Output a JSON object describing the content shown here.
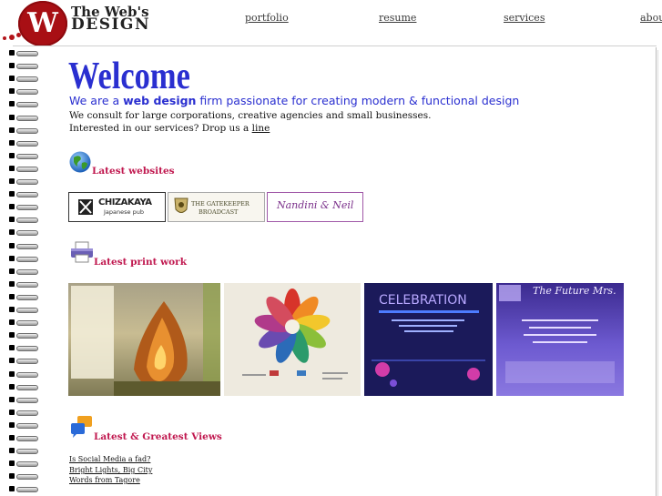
{
  "header": {
    "logo_letter": "W",
    "brand_line1": "The Web's",
    "brand_line2": "DESIGN",
    "nav": [
      {
        "label": "portfolio"
      },
      {
        "label": "resume"
      },
      {
        "label": "services"
      },
      {
        "label": "about"
      }
    ]
  },
  "intro": {
    "heading": "Welcome",
    "tagline_prefix": "We are a ",
    "tagline_bold": "web design",
    "tagline_suffix": " firm passionate for creating modern & functional design",
    "consult": "We consult for large corporations, creative agencies and small businesses.",
    "interested_prefix": "Interested in our services? Drop us a ",
    "interested_link": "line"
  },
  "websites": {
    "title": "Latest websites",
    "items": [
      {
        "name": "CHIZAKAYA",
        "sub": "Japanese pub"
      },
      {
        "name": "THE GATEKEEPER",
        "sub": "BROADCAST"
      },
      {
        "name": "Nandini & Neil"
      }
    ]
  },
  "print": {
    "title": "Latest print work",
    "items": [
      {
        "name": "diya-poster"
      },
      {
        "name": "leaf-wheel-poster"
      },
      {
        "name": "celebration-invite",
        "headline": "CELEBRATION"
      },
      {
        "name": "future-mrs-invite",
        "headline": "The Future Mrs."
      }
    ]
  },
  "views": {
    "title": "Latest & Greatest Views",
    "links": [
      {
        "label": "Is Social Media a fad?"
      },
      {
        "label": "Bright Lights, Big City"
      },
      {
        "label": "Words from Tagore"
      }
    ]
  },
  "colors": {
    "brand_red": "#a80f14",
    "heading_blue": "#2a2fd0",
    "section_pink": "#c0184f"
  }
}
